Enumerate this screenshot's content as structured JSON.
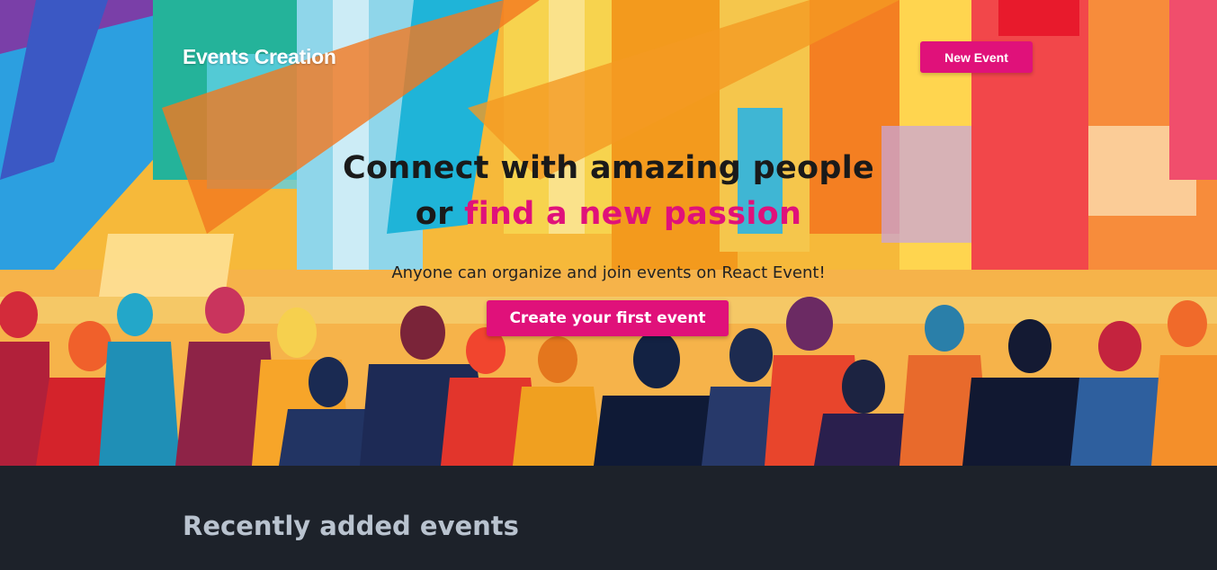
{
  "navbar": {
    "brand": "Events Creation",
    "new_event_label": "New Event"
  },
  "hero": {
    "headline_line1": "Connect with amazing people",
    "headline_or": "or",
    "headline_accent": "find a new passion",
    "subline": "Anyone can organize and join events on React Event!",
    "cta_label": "Create your first event",
    "image_description_icon": "crowd-illustration"
  },
  "recent": {
    "title": "Recently added events"
  },
  "colors": {
    "accent": "#e0117a",
    "dark_bg": "#1d222a",
    "section_title": "#b9c3cf"
  }
}
